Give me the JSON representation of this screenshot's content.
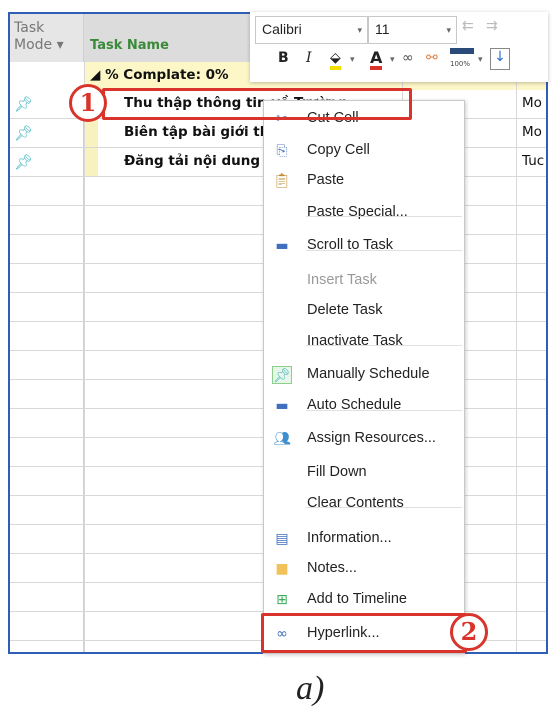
{
  "grid": {
    "col_task_mode": "Task\nMode ▾",
    "col_task_name": "Task Name",
    "summary": "◢ % Complate: 0%",
    "tasks": [
      {
        "name": "Thu thập thông tin về Trường",
        "resource": "Mo"
      },
      {
        "name": "Biên tập bài giới thiệu",
        "resource": "Mo"
      },
      {
        "name": "Đăng tải nội dung",
        "resource": "Tuc"
      }
    ]
  },
  "toolbar": {
    "font": "Calibri",
    "size": "11",
    "bold": "B",
    "italic": "I",
    "font_color": "A",
    "zoom_label": "100%"
  },
  "menu": {
    "items": [
      {
        "label": "Cut Cell",
        "icon": "scissors-icon"
      },
      {
        "label": "Copy Cell",
        "icon": "copy-icon"
      },
      {
        "label": "Paste",
        "icon": "paste-icon"
      },
      {
        "label": "Paste Special...",
        "icon": ""
      },
      {
        "label": "Scroll to Task",
        "icon": "scroll-to-task-icon"
      },
      {
        "label": "Insert Task",
        "icon": "",
        "disabled": true
      },
      {
        "label": "Delete Task",
        "icon": ""
      },
      {
        "label": "Inactivate Task",
        "icon": ""
      },
      {
        "label": "Manually Schedule",
        "icon": "pin-icon"
      },
      {
        "label": "Auto Schedule",
        "icon": "auto-schedule-icon"
      },
      {
        "label": "Assign Resources...",
        "icon": "people-icon"
      },
      {
        "label": "Fill Down",
        "icon": ""
      },
      {
        "label": "Clear Contents",
        "icon": ""
      },
      {
        "label": "Information...",
        "icon": "information-icon"
      },
      {
        "label": "Notes...",
        "icon": "note-icon"
      },
      {
        "label": "Add to Timeline",
        "icon": "timeline-icon"
      },
      {
        "label": "Hyperlink...",
        "icon": "hyperlink-icon"
      }
    ]
  },
  "annotations": {
    "step1": "1",
    "step2": "2"
  },
  "caption": "a)",
  "colors": {
    "annotation": "#d9342b",
    "frame": "#2f5eb5",
    "task_name_header": "#3a8a3a"
  }
}
